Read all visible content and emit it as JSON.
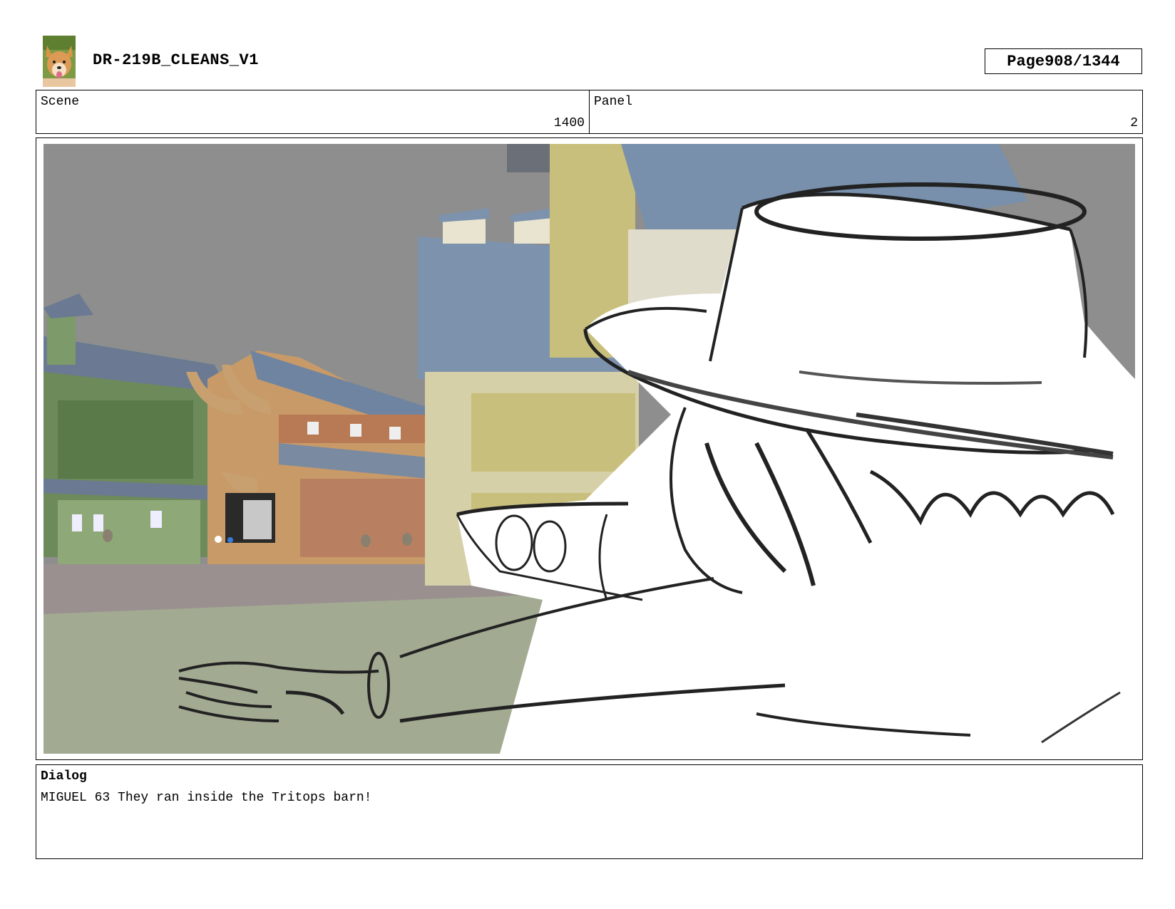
{
  "header": {
    "title": "DR-219B_CLEANS_V1",
    "page_label": "Page",
    "page_number": "908/1344"
  },
  "info": {
    "scene_label": "Scene",
    "scene_value": "1400",
    "panel_label": "Panel",
    "panel_value": "2"
  },
  "panel_image": {
    "icon": "storyboard-panel-image"
  },
  "dialog": {
    "label": "Dialog",
    "text": "MIGUEL 63 They ran inside the Tritops barn!"
  }
}
